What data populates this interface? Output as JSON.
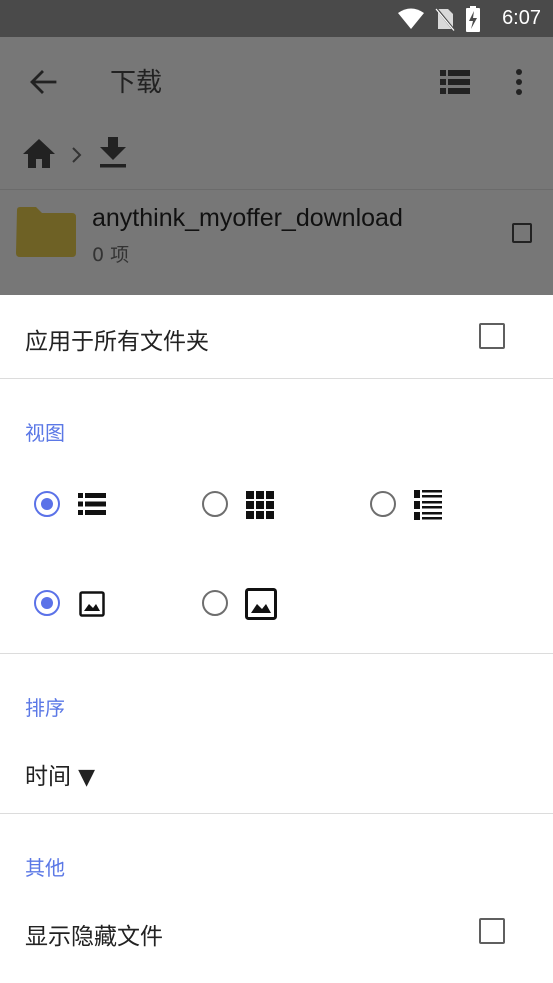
{
  "status_bar": {
    "time": "6:07"
  },
  "toolbar": {
    "title": "下载"
  },
  "file_list": [
    {
      "name": "anythink_myoffer_download",
      "count": "0 项"
    }
  ],
  "sheet": {
    "apply_all_label": "应用于所有文件夹",
    "view_section": "视图",
    "view_modes": [
      "list",
      "grid",
      "detailed-list"
    ],
    "thumbnail_modes": [
      "small-thumbnail",
      "large-thumbnail"
    ],
    "sort_section": "排序",
    "sort_value": "时间",
    "sort_direction_glyph": "▼",
    "other_section": "其他",
    "show_hidden_label": "显示隐藏文件"
  },
  "colors": {
    "accent": "#5b72e8",
    "section_title": "#5b78e6",
    "folder": "#6e6125"
  }
}
